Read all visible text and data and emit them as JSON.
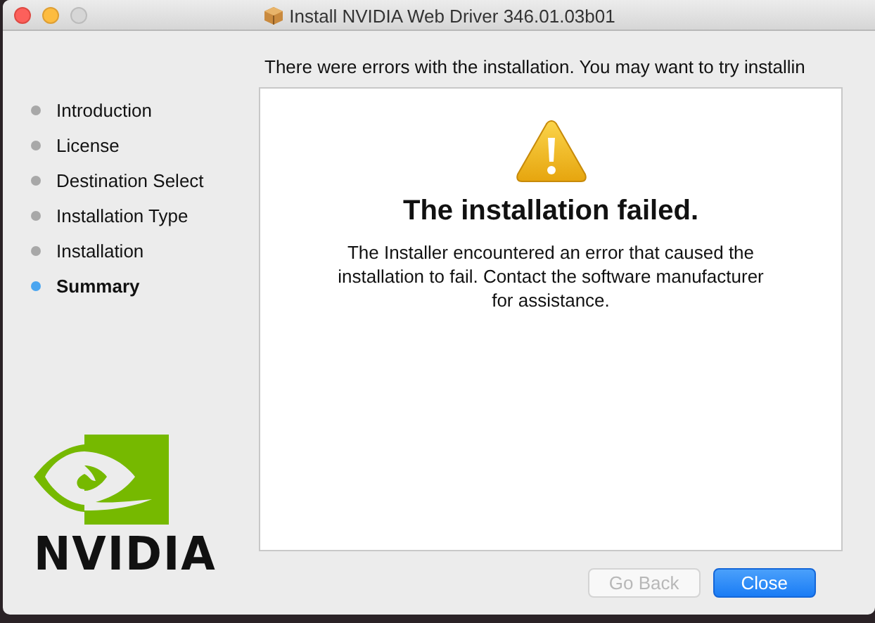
{
  "window": {
    "title": "Install NVIDIA Web Driver 346.01.03b01"
  },
  "message": "There were errors with the installation. You may want to try installin",
  "steps": [
    {
      "label": "Introduction",
      "selected": false
    },
    {
      "label": "License",
      "selected": false
    },
    {
      "label": "Destination Select",
      "selected": false
    },
    {
      "label": "Installation Type",
      "selected": false
    },
    {
      "label": "Installation",
      "selected": false
    },
    {
      "label": "Summary",
      "selected": true
    }
  ],
  "logo": {
    "wordmark": "NVIDIA"
  },
  "result": {
    "heading": "The installation failed.",
    "body": "The Installer encountered an error that caused the installation to fail. Contact the software manufacturer for assistance."
  },
  "buttons": [
    {
      "label": "Go Back",
      "disabled": true,
      "default": false
    },
    {
      "label": "Close",
      "disabled": false,
      "default": true
    }
  ]
}
